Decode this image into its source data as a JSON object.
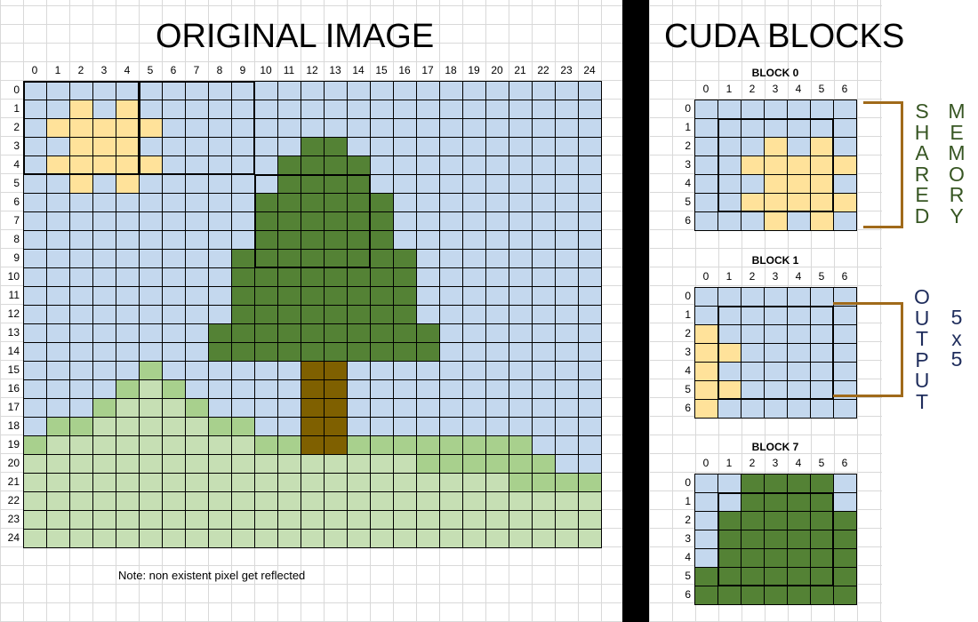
{
  "titles": {
    "original": "ORIGINAL IMAGE",
    "cuda": "CUDA BLOCKS"
  },
  "note": "Note: non existent pixel get reflected",
  "colors": {
    "S": "#c4d8ee",
    "Y": "#ffe29a",
    "T": "#548235",
    "B": "#7f6000",
    "G": "#c6dfb4",
    "D": "#a8d08d",
    "bracket": "#a06a1a",
    "shared_text": "#375623",
    "output_text": "#1f2d5c"
  },
  "original_grid": {
    "axis_labels": [
      "0",
      "1",
      "2",
      "3",
      "4",
      "5",
      "6",
      "7",
      "8",
      "9",
      "10",
      "11",
      "12",
      "13",
      "14",
      "15",
      "16",
      "17",
      "18",
      "19",
      "20",
      "21",
      "22",
      "23",
      "24"
    ],
    "rows": [
      "SSSSSSSSSSSSSSSSSSSSSSSSS",
      "SSYSYSSSSSSSSSSSSSSSSSSSS",
      "SYYYYYSSSSSSSSSSSSSSSSSSS",
      "SSYYYSSSSSSSTTSSSSSSSSSSS",
      "SYYYYYSSSSSTTTTSSSSSSSSSS",
      "SSYSYSSSSSSTTTTSSSSSSSSSS",
      "SSSSSSSSSSTTTTTTSSSSSSSSS",
      "SSSSSSSSSSTTTTTTSSSSSSSSS",
      "SSSSSSSSSSTTTTTTSSSSSSSSS",
      "SSSSSSSSSTTTTTTTTSSSSSSSS",
      "SSSSSSSSSTTTTTTTTSSSSSSSS",
      "SSSSSSSSSTTTTTTTTSSSSSSSS",
      "SSSSSSSSSTTTTTTTTSSSSSSSS",
      "SSSSSSSSTTTTTTTTTTSSSSSSS",
      "SSSSSSSSTTTTTTTTTTSSSSSSS",
      "SSSSSDSSSSSSBBSSSSSSSSSSS",
      "SSSSDGDSSSSSBBSSSSSSSSSSS",
      "SSSDGGGDSSSSBBSSSSSSSSSSS",
      "SDDGGGGGDDSSBBSSSSSSSSSSS",
      "DGGGGGGGGGDDBBDDDDDDDDSSS",
      "GGGGGGGGGGGGGGGGGDDDDDDSS",
      "GGGGGGGGGGGGGGGGGGGGGDDDD",
      "GGGGGGGGGGGGGGGGGGGGGGGGG",
      "GGGGGGGGGGGGGGGGGGGGGGGGG",
      "GGGGGGGGGGGGGGGGGGGGGGGGG"
    ]
  },
  "blocks": [
    {
      "label": "BLOCK 0",
      "axis_labels": [
        "0",
        "1",
        "2",
        "3",
        "4",
        "5",
        "6"
      ],
      "rows": [
        "SSSSSSS",
        "SSSSSSS",
        "SSSYSYS",
        "SSYYYYY",
        "SSSYYYS",
        "SSYYYYY",
        "SSSYSYS"
      ]
    },
    {
      "label": "BLOCK 1",
      "axis_labels": [
        "0",
        "1",
        "2",
        "3",
        "4",
        "5",
        "6"
      ],
      "rows": [
        "SSSSSSS",
        "SSSSSSS",
        "YSSSSSS",
        "YYSSSSS",
        "YSSSSSS",
        "YYSSSSS",
        "YSSSSSS"
      ]
    },
    {
      "label": "BLOCK 7",
      "axis_labels": [
        "0",
        "1",
        "2",
        "3",
        "4",
        "5",
        "6"
      ],
      "rows": [
        "SSTTTTS",
        "SSTTTTS",
        "STTTTTT",
        "STTTTTT",
        "STTTTTT",
        "TTTTTTT",
        "TTTTTTT"
      ]
    }
  ],
  "shared_label": [
    "S",
    "H",
    "A",
    "R",
    "E",
    "D"
  ],
  "memory_label": [
    "M",
    "E",
    "M",
    "O",
    "R",
    "Y"
  ],
  "output_label": [
    "O",
    "U",
    "T",
    "P",
    "U",
    "T"
  ],
  "size_label": [
    "5",
    "x",
    "5"
  ]
}
